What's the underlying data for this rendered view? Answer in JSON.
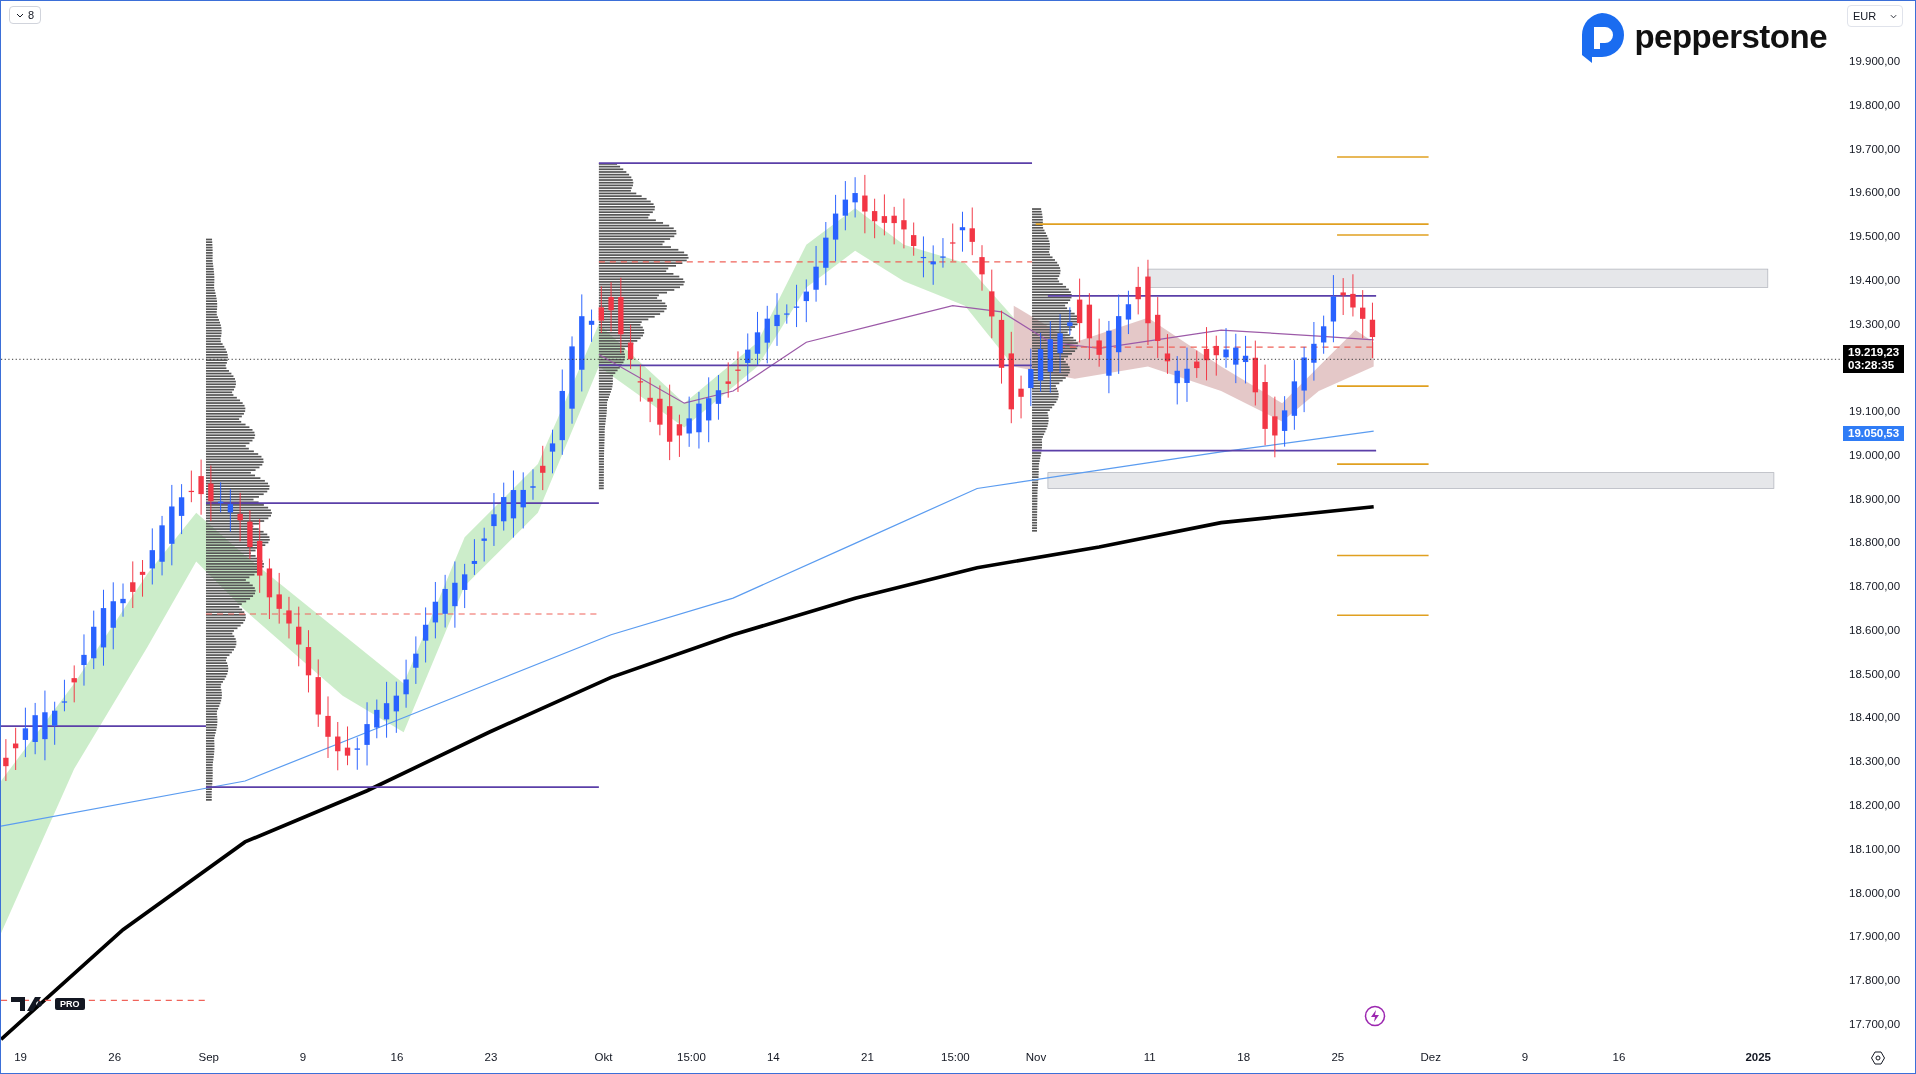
{
  "interval_button": {
    "label": "8"
  },
  "currency_select": {
    "value": "EUR"
  },
  "logo": {
    "name": "pepperstone"
  },
  "price_axis": {
    "labels_above": [
      "19.900,00",
      "19.800,00",
      "19.700,00",
      "19.600,00",
      "19.500,00",
      "19.400,00",
      "19.300,00"
    ],
    "labels_below": [
      "19.100,00",
      "19.000,00",
      "18.900,00",
      "18.800,00",
      "18.700,00",
      "18.600,00",
      "18.500,00",
      "18.400,00",
      "18.300,00",
      "18.200,00",
      "18.100,00",
      "18.000,00",
      "17.900,00",
      "17.800,00",
      "17.700,00"
    ]
  },
  "last_price_badge": {
    "price": "19.219,23",
    "countdown": "03:28:35"
  },
  "average_badge": {
    "price": "19.050,53"
  },
  "chart_logo": {
    "badge": "PRO"
  },
  "time_axis": {
    "labels": [
      "19",
      "26",
      "Sep",
      "9",
      "16",
      "23",
      "Okt",
      "15:00",
      "14",
      "21",
      "15:00",
      "Nov",
      "11",
      "18",
      "25",
      "Dez",
      "9",
      "16",
      "2025"
    ]
  }
}
